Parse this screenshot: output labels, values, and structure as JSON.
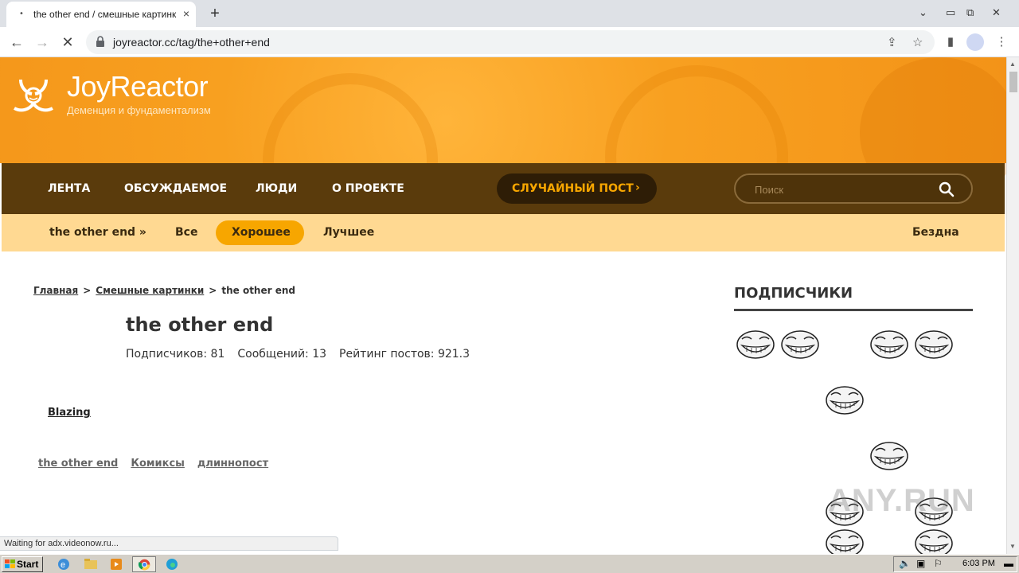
{
  "browser": {
    "tab_title": "the other end / смешные картинки",
    "tab_close": "×",
    "newtab": "+",
    "url": "joyreactor.cc/tag/the+other+end"
  },
  "site": {
    "logo_text": "JoyReactor",
    "tagline": "Деменция и фундаментализм",
    "nav": [
      "ЛЕНТА",
      "ОБСУЖДАЕМОЕ",
      "ЛЮДИ",
      "О ПРОЕКТЕ"
    ],
    "random_post": "СЛУЧАЙНЫЙ ПОСТ",
    "random_chevron": "›",
    "search_placeholder": "Поиск",
    "subnav": {
      "tag": "the other end »",
      "all": "Все",
      "good": "Хорошее",
      "best": "Лучшее",
      "abyss": "Бездна"
    },
    "accent": "#f7a600"
  },
  "breadcrumb": {
    "home": "Главная",
    "sep": ">",
    "section": "Смешные картинки",
    "current": "the other end"
  },
  "tag": {
    "title": "the other end",
    "subscribers": "Подписчиков: 81",
    "posts": "Сообщений: 13",
    "rating": "Рейтинг постов: 921.3"
  },
  "blazing": "Blazing",
  "post_tags": [
    "the other end",
    "Комиксы",
    "длиннопост"
  ],
  "sidebar": {
    "subscribers_heading": "ПОДПИСЧИКИ",
    "avatar_icon": "trollface-icon"
  },
  "watermark": "ANY.RUN",
  "status_text": "Waiting for adx.videonow.ru...",
  "taskbar": {
    "start": "Start",
    "clock": "6:03 PM"
  }
}
